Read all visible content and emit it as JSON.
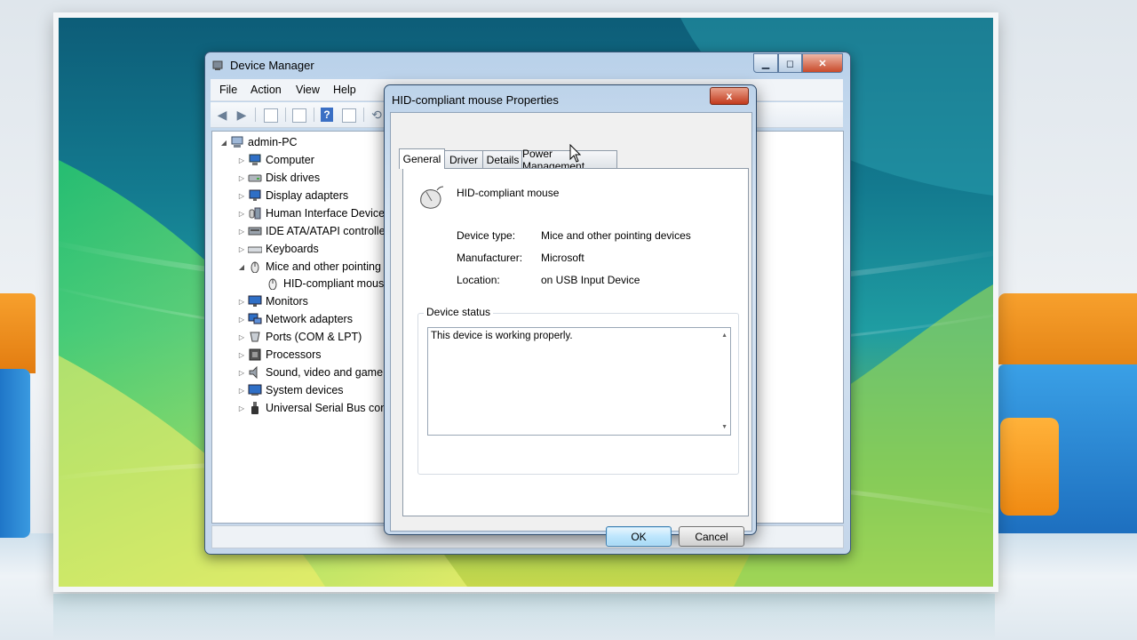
{
  "device_manager": {
    "title": "Device Manager",
    "menu": [
      "File",
      "Action",
      "View",
      "Help"
    ],
    "toolbar_icons": [
      "back-arrow-icon",
      "forward-arrow-icon",
      "show-hide-tree-icon",
      "properties-icon",
      "help-icon",
      "view-icon",
      "scan-hardware-icon"
    ],
    "tree": {
      "root": "admin-PC",
      "items": [
        {
          "label": "Computer",
          "icon": "computer-icon",
          "expanded": false
        },
        {
          "label": "Disk drives",
          "icon": "disk-drive-icon",
          "expanded": false
        },
        {
          "label": "Display adapters",
          "icon": "display-adapter-icon",
          "expanded": false
        },
        {
          "label": "Human Interface Device",
          "icon": "hid-icon",
          "expanded": false
        },
        {
          "label": "IDE ATA/ATAPI controlle",
          "icon": "ide-controller-icon",
          "expanded": false
        },
        {
          "label": "Keyboards",
          "icon": "keyboard-icon",
          "expanded": false
        },
        {
          "label": "Mice and other pointing",
          "icon": "mouse-icon",
          "expanded": true
        },
        {
          "label": "HID-compliant mous",
          "icon": "mouse-icon",
          "child": true
        },
        {
          "label": "Monitors",
          "icon": "monitor-icon",
          "expanded": false
        },
        {
          "label": "Network adapters",
          "icon": "network-adapter-icon",
          "expanded": false
        },
        {
          "label": "Ports (COM & LPT)",
          "icon": "port-icon",
          "expanded": false
        },
        {
          "label": "Processors",
          "icon": "processor-icon",
          "expanded": false
        },
        {
          "label": "Sound, video and game",
          "icon": "sound-icon",
          "expanded": false
        },
        {
          "label": "System devices",
          "icon": "system-device-icon",
          "expanded": false
        },
        {
          "label": "Universal Serial Bus cont",
          "icon": "usb-icon",
          "expanded": false
        }
      ]
    }
  },
  "properties": {
    "title": "HID-compliant mouse Properties",
    "close_label": "x",
    "tabs": [
      "General",
      "Driver",
      "Details",
      "Power Management"
    ],
    "active_tab": "General",
    "device_name": "HID-compliant mouse",
    "fields": [
      {
        "label": "Device type:",
        "value": "Mice and other pointing devices"
      },
      {
        "label": "Manufacturer:",
        "value": "Microsoft"
      },
      {
        "label": "Location:",
        "value": "on USB Input Device"
      }
    ],
    "status_group_title": "Device status",
    "status_text": "This device is working properly.",
    "ok_label": "OK",
    "cancel_label": "Cancel"
  },
  "colors": {
    "title_bar": "#c4d6ea",
    "close_button": "#c84a2a",
    "default_button": "#bee6fd"
  }
}
